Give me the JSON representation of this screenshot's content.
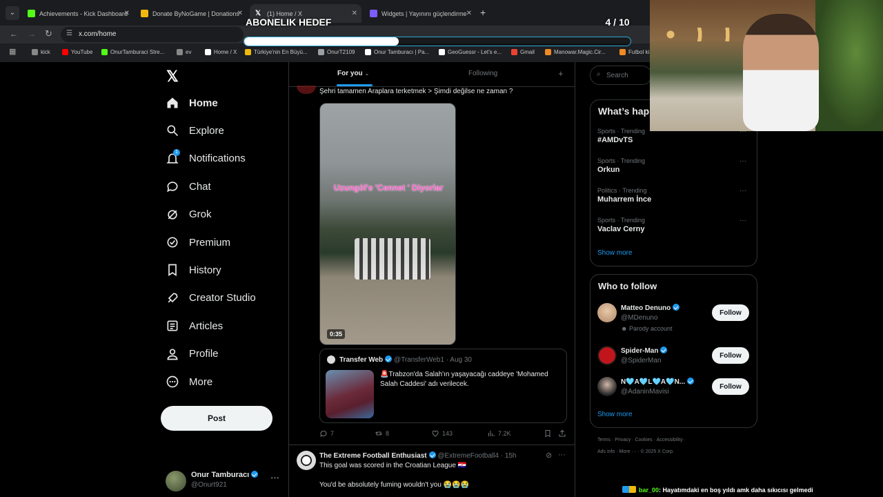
{
  "browser": {
    "tabs": [
      {
        "label": "Achievements - Kick Dashboard",
        "fav": "#53fc18"
      },
      {
        "label": "Donate ByNoGame | Donations",
        "fav": "#f0b90b"
      },
      {
        "label": "(1) Home / X",
        "fav": "#ffffff"
      },
      {
        "label": "Widgets | Yayınını güçlendirme",
        "fav": "#7c5cff"
      }
    ],
    "url": "x.com/home",
    "bookmarks": [
      {
        "label": "kick",
        "color": "#888888"
      },
      {
        "label": "YouTube",
        "color": "#ff0000"
      },
      {
        "label": "OnurTamburaci Stre...",
        "color": "#53fc18"
      },
      {
        "label": "ev",
        "color": "#888888"
      },
      {
        "label": "Home / X",
        "color": "#ffffff"
      },
      {
        "label": "Türkiye'nin En Büyü...",
        "color": "#f0b90b"
      },
      {
        "label": "OnurT2109",
        "color": "#9aa0a6"
      },
      {
        "label": "Onur Tamburacı | Pa...",
        "color": "#ffffff"
      },
      {
        "label": "GeoGuessr - Let's e...",
        "color": "#ffffff"
      },
      {
        "label": "Gmail",
        "color": "#ea4335"
      },
      {
        "label": "Manowar.Magic.Cir...",
        "color": "#f08a24"
      },
      {
        "label": "Futbol ki",
        "color": "#f08a24"
      }
    ]
  },
  "overlay": {
    "title": "ABONELIK HEDEF",
    "count": "4 / 10",
    "progress": 0.4
  },
  "sidebar": {
    "items": [
      {
        "label": "Home",
        "icon": "home-icon"
      },
      {
        "label": "Explore",
        "icon": "search-icon"
      },
      {
        "label": "Notifications",
        "icon": "bell-icon",
        "badge": "1"
      },
      {
        "label": "Chat",
        "icon": "chat-icon"
      },
      {
        "label": "Grok",
        "icon": "grok-icon"
      },
      {
        "label": "Premium",
        "icon": "premium-icon"
      },
      {
        "label": "History",
        "icon": "bookmark-icon"
      },
      {
        "label": "Creator Studio",
        "icon": "rocket-icon"
      },
      {
        "label": "Articles",
        "icon": "articles-icon"
      },
      {
        "label": "Profile",
        "icon": "profile-icon"
      },
      {
        "label": "More",
        "icon": "more-circle-icon"
      }
    ],
    "post_label": "Post",
    "account": {
      "name": "Onur Tamburacı",
      "handle": "@Onurt921"
    }
  },
  "feed": {
    "tabs": [
      "For you",
      "Following"
    ],
    "post1": {
      "text": "Şehri tamamen Araplara terketmek > Şimdi değilse ne zaman ?",
      "video_caption": "Uzungöl'e 'Cennet ' Diyorlar",
      "duration": "0:35",
      "quote": {
        "name": "Transfer Web",
        "handle": "@TransferWeb1",
        "date": "Aug 30",
        "text": "🚨Trabzon'da Salah'ın yaşayacağı caddeye 'Mohamed Salah Caddesi' adı verilecek."
      },
      "replies": "7",
      "reposts": "8",
      "likes": "143",
      "views": "7.2K"
    },
    "post2": {
      "name": "The Extreme Football Enthusiast",
      "handle": "@ExtremeFootball4",
      "time": "15h",
      "line1": "This goal was scored in the Croatian League 🇭🇷",
      "line2": "You'd be absolutely fuming wouldn't you 😭😭😭"
    }
  },
  "right": {
    "search_placeholder": "Search",
    "trending_title": "What’s hap",
    "trends": [
      {
        "meta": "Sports · Trending",
        "name": "#AMDvTS"
      },
      {
        "meta": "Sports · Trending",
        "name": "Orkun"
      },
      {
        "meta": "Politics · Trending",
        "name": "Muharrem İnce"
      },
      {
        "meta": "Sports · Trending",
        "name": "Vaclav Cerny"
      }
    ],
    "show_more": "Show more",
    "who_title": "Who to follow",
    "follow": [
      {
        "name": "Matteo Denuno",
        "handle": "@MDenuno",
        "note": "Parody account"
      },
      {
        "name": "Spider-Man",
        "handle": "@SpiderMan",
        "note": ""
      },
      {
        "name": "N🩵A🩵L🩵A🩵N...",
        "handle": "@AdaninMavisi",
        "note": ""
      }
    ],
    "follow_label": "Follow",
    "show_more2": "Show more",
    "footer1": "Terms · Privacy · Cookies · Accessibility ·",
    "footer2": "Ads info · More ··· · © 2025 X Corp."
  },
  "chat": {
    "user": "bar_00",
    "message": ": Hayatımdaki en boş yıldı amk daha sıkıcısı gelmedi"
  }
}
